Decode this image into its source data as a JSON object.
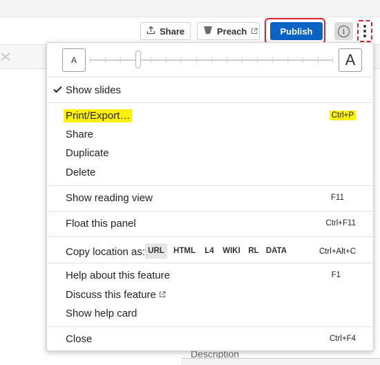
{
  "toolbar": {
    "share_label": "Share",
    "preach_label": "Preach",
    "publish_label": "Publish",
    "info_glyph": "i"
  },
  "menu": {
    "font_size_small": "A",
    "font_size_large": "A",
    "font_size_level": 0.2,
    "show_slides": "Show slides",
    "print_export": "Print/Export…",
    "print_export_shortcut": "Ctrl+P",
    "share": "Share",
    "duplicate": "Duplicate",
    "delete": "Delete",
    "show_reading_view": "Show reading view",
    "show_reading_view_shortcut": "F11",
    "float_panel": "Float this panel",
    "float_panel_shortcut": "Ctrl+F11",
    "copy_location_label": "Copy location as:",
    "copy_formats": [
      "URL",
      "HTML",
      "L4",
      "WIKI",
      "RL",
      "DATA"
    ],
    "copy_location_shortcut": "Ctrl+Alt+C",
    "help_feature": "Help about this feature",
    "help_feature_shortcut": "F1",
    "discuss_feature": "Discuss this feature",
    "show_help_card": "Show help card",
    "close": "Close",
    "close_shortcut": "Ctrl+F4"
  },
  "background": {
    "description_label": "Description"
  },
  "colors": {
    "publish": "#0b63c5",
    "annotation_red": "#e0222e",
    "highlight_yellow": "#fff200"
  },
  "icons": [
    "upload-icon",
    "preach-icon",
    "external-link-icon",
    "info-icon",
    "more-vertical-icon",
    "checkmark-icon",
    "clear-filter-icon"
  ]
}
